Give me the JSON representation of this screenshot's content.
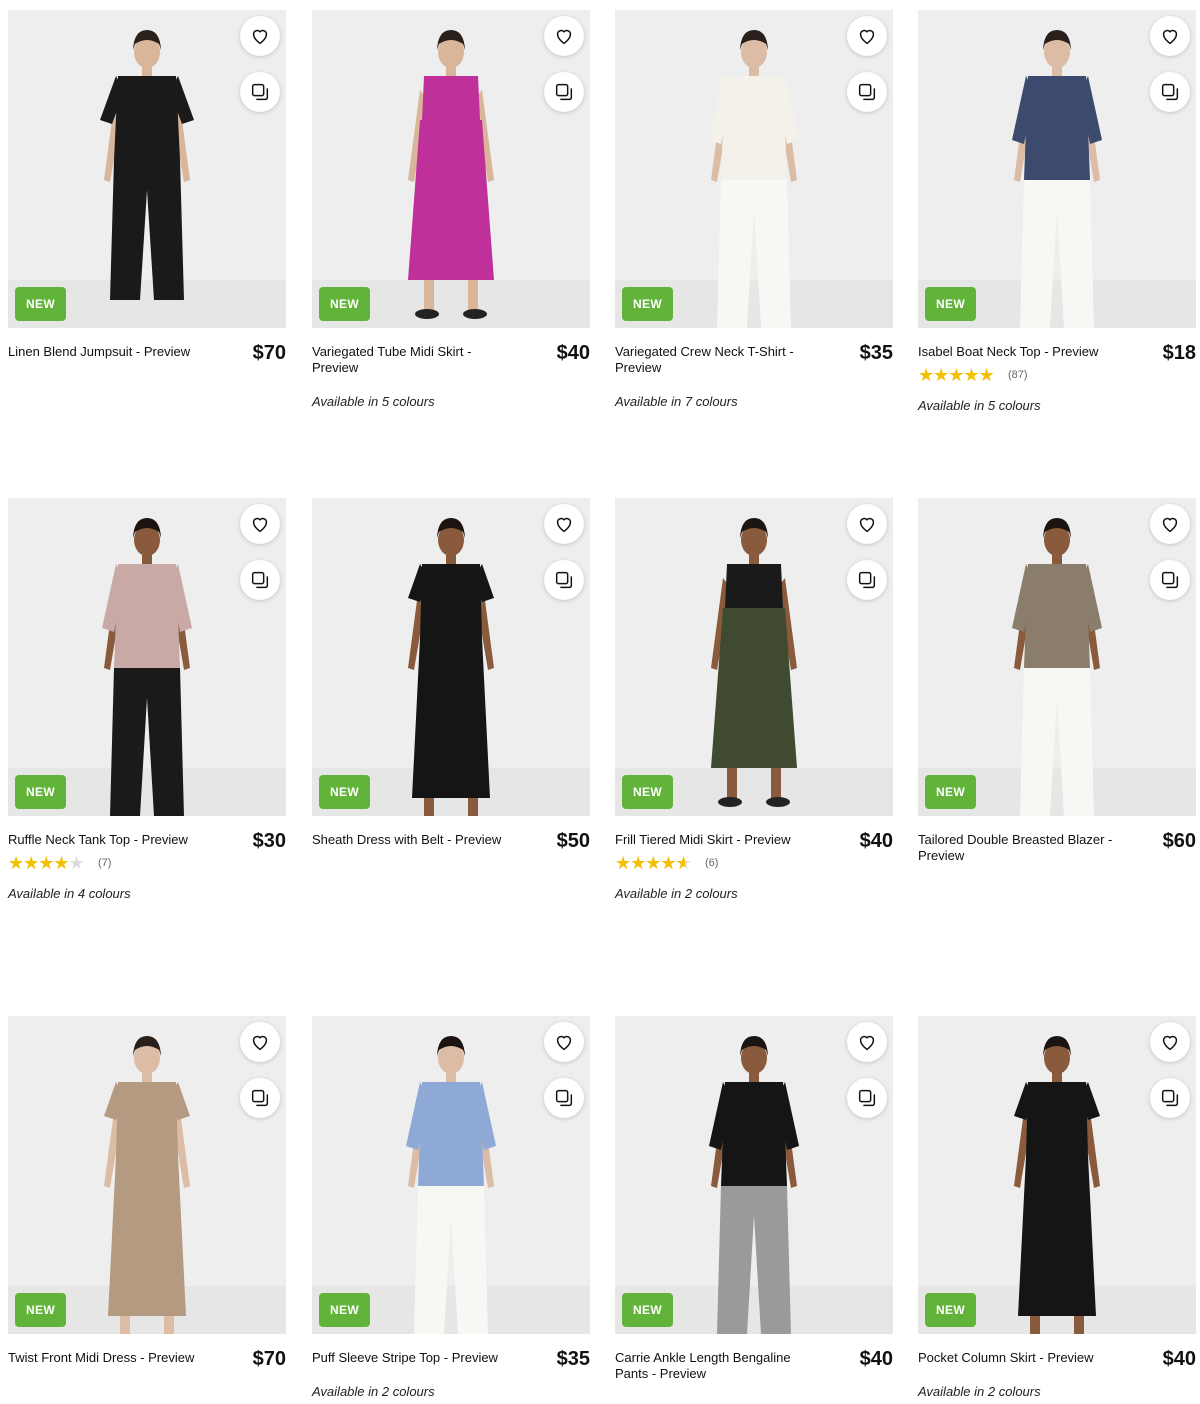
{
  "icons": {
    "wishlist": "heart-icon",
    "compare": "compare-icon"
  },
  "colors": {
    "new_badge": "#62b33a",
    "star": "#f2c200"
  },
  "products": [
    {
      "title": "Linen Blend Jumpsuit - Preview",
      "price": "$70",
      "badge": "NEW",
      "availability": "",
      "rating": null,
      "review_count": "",
      "look": {
        "top": "#1a1a1a",
        "bottom": "#1a1a1a",
        "skin": "#d9b59a",
        "hair": "#2a1f1a",
        "type": "jumpsuit"
      }
    },
    {
      "title": "Variegated Tube Midi Skirt - Preview",
      "price": "$40",
      "badge": "NEW",
      "availability": "Available in 5 colours",
      "rating": null,
      "review_count": "",
      "look": {
        "top": "#c0309a",
        "bottom": "#c0309a",
        "skin": "#d9b59a",
        "hair": "#2a1f1a",
        "type": "skirt-crop"
      }
    },
    {
      "title": "Variegated Crew Neck T-Shirt - Preview",
      "price": "$35",
      "badge": "NEW",
      "availability": "Available in 7 colours",
      "rating": null,
      "review_count": "",
      "look": {
        "top": "#f3f1ea",
        "bottom": "#f7f7f4",
        "skin": "#dcbca4",
        "hair": "#2a1f1a",
        "type": "top-pants"
      }
    },
    {
      "title": "Isabel Boat Neck Top - Preview",
      "price": "$18",
      "badge": "NEW",
      "availability": "Available in 5 colours",
      "rating": 4.5,
      "review_count": "(87)",
      "look": {
        "top": "#3c4a6e",
        "bottom": "#f7f7f4",
        "skin": "#dcbca4",
        "hair": "#2a1f1a",
        "type": "top-pants"
      }
    },
    {
      "title": "Ruffle Neck Tank Top - Preview",
      "price": "$30",
      "badge": "NEW",
      "availability": "Available in 4 colours",
      "rating": 3.5,
      "review_count": "(7)",
      "look": {
        "top": "#c9a9a6",
        "bottom": "#1a1a1a",
        "skin": "#8a5a3c",
        "hair": "#1b1410",
        "type": "top-pants"
      }
    },
    {
      "title": "Sheath Dress with Belt - Preview",
      "price": "$50",
      "badge": "NEW",
      "availability": "",
      "rating": null,
      "review_count": "",
      "look": {
        "top": "#151515",
        "bottom": "#151515",
        "skin": "#8a5a3c",
        "hair": "#1b1410",
        "type": "dress"
      }
    },
    {
      "title": "Frill Tiered Midi Skirt - Preview",
      "price": "$40",
      "badge": "NEW",
      "availability": "Available in 2 colours",
      "rating": 4.0,
      "review_count": "(6)",
      "look": {
        "top": "#1a1a1a",
        "bottom": "#3f4a30",
        "skin": "#8a5a3c",
        "hair": "#1b1410",
        "type": "skirt-crop"
      }
    },
    {
      "title": "Tailored Double Breasted Blazer - Preview",
      "price": "$60",
      "badge": "NEW",
      "availability": "",
      "rating": null,
      "review_count": "",
      "look": {
        "top": "#8b7d6b",
        "bottom": "#f7f7f4",
        "skin": "#8a5a3c",
        "hair": "#1b1410",
        "type": "top-pants"
      }
    },
    {
      "title": "Twist Front Midi Dress - Preview",
      "price": "$70",
      "badge": "NEW",
      "availability": "",
      "rating": null,
      "review_count": "",
      "look": {
        "top": "#b39a80",
        "bottom": "#b39a80",
        "skin": "#dcbca4",
        "hair": "#2a1f1a",
        "type": "dress"
      }
    },
    {
      "title": "Puff Sleeve Stripe Top - Preview",
      "price": "$35",
      "badge": "NEW",
      "availability": "Available in 2 colours",
      "rating": null,
      "review_count": "",
      "look": {
        "top": "#8fa9d6",
        "bottom": "#f7f7f4",
        "skin": "#dcbca4",
        "hair": "#1b1410",
        "type": "top-pants"
      }
    },
    {
      "title": "Carrie Ankle Length Bengaline Pants - Preview",
      "price": "$40",
      "badge": "NEW",
      "availability": "",
      "rating": null,
      "review_count": "",
      "look": {
        "top": "#151515",
        "bottom": "#9a9a98",
        "skin": "#8a5a3c",
        "hair": "#1b1410",
        "type": "top-pants"
      }
    },
    {
      "title": "Pocket Column Skirt - Preview",
      "price": "$40",
      "badge": "NEW",
      "availability": "Available in 2 colours",
      "rating": null,
      "review_count": "",
      "look": {
        "top": "#151515",
        "bottom": "#151515",
        "skin": "#8a5a3c",
        "hair": "#1b1410",
        "type": "dress"
      }
    }
  ]
}
